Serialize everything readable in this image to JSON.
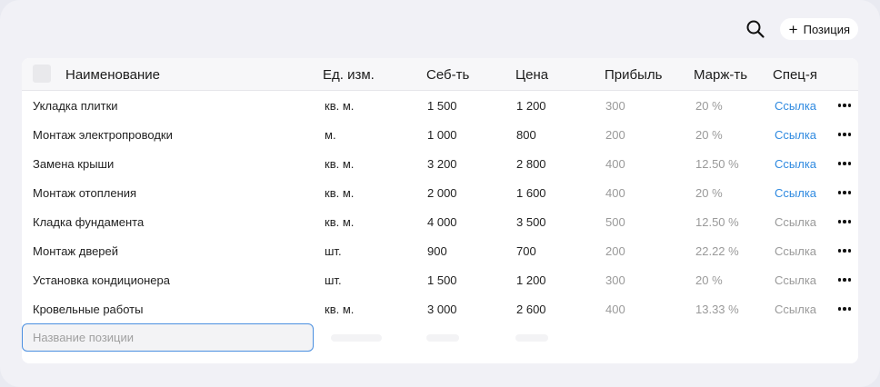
{
  "toolbar": {
    "add_label": "Позиция"
  },
  "table": {
    "headers": {
      "name": "Наименование",
      "unit": "Ед. изм.",
      "cost": "Себ-ть",
      "price": "Цена",
      "profit": "Прибыль",
      "margin": "Марж-ть",
      "spec": "Спец-я"
    },
    "rows": [
      {
        "name": "Укладка плитки",
        "unit": "кв. м.",
        "cost": "1 500",
        "price": "1 200",
        "profit": "300",
        "margin": "20 %",
        "spec": "Ссылка",
        "spec_active": true
      },
      {
        "name": "Монтаж электропроводки",
        "unit": "м.",
        "cost": "1 000",
        "price": "800",
        "profit": "200",
        "margin": "20 %",
        "spec": "Ссылка",
        "spec_active": true
      },
      {
        "name": "Замена крыши",
        "unit": "кв. м.",
        "cost": "3 200",
        "price": "2 800",
        "profit": "400",
        "margin": "12.50 %",
        "spec": "Ссылка",
        "spec_active": true
      },
      {
        "name": "Монтаж отопления",
        "unit": "кв. м.",
        "cost": "2 000",
        "price": "1 600",
        "profit": "400",
        "margin": "20 %",
        "spec": "Ссылка",
        "spec_active": true
      },
      {
        "name": "Кладка фундамента",
        "unit": "кв. м.",
        "cost": "4 000",
        "price": "3 500",
        "profit": "500",
        "margin": "12.50 %",
        "spec": "Ссылка",
        "spec_active": false
      },
      {
        "name": "Монтаж дверей",
        "unit": "шт.",
        "cost": "900",
        "price": "700",
        "profit": "200",
        "margin": "22.22 %",
        "spec": "Ссылка",
        "spec_active": false
      },
      {
        "name": "Установка кондиционера",
        "unit": "шт.",
        "cost": "1 500",
        "price": "1 200",
        "profit": "300",
        "margin": "20 %",
        "spec": "Ссылка",
        "spec_active": false
      },
      {
        "name": "Кровельные работы",
        "unit": "кв. м.",
        "cost": "3 000",
        "price": "2 600",
        "profit": "400",
        "margin": "13.33 %",
        "spec": "Ссылка",
        "spec_active": false
      }
    ]
  },
  "new_position": {
    "placeholder": "Название позиции",
    "value": ""
  },
  "colors": {
    "link": "#2f8ae0",
    "focus_border": "#4a8fe0",
    "background": "#f1f1f6"
  },
  "icons": {
    "search": "search-icon",
    "add": "plus-icon",
    "row_menu": "more-horizontal-icon"
  }
}
